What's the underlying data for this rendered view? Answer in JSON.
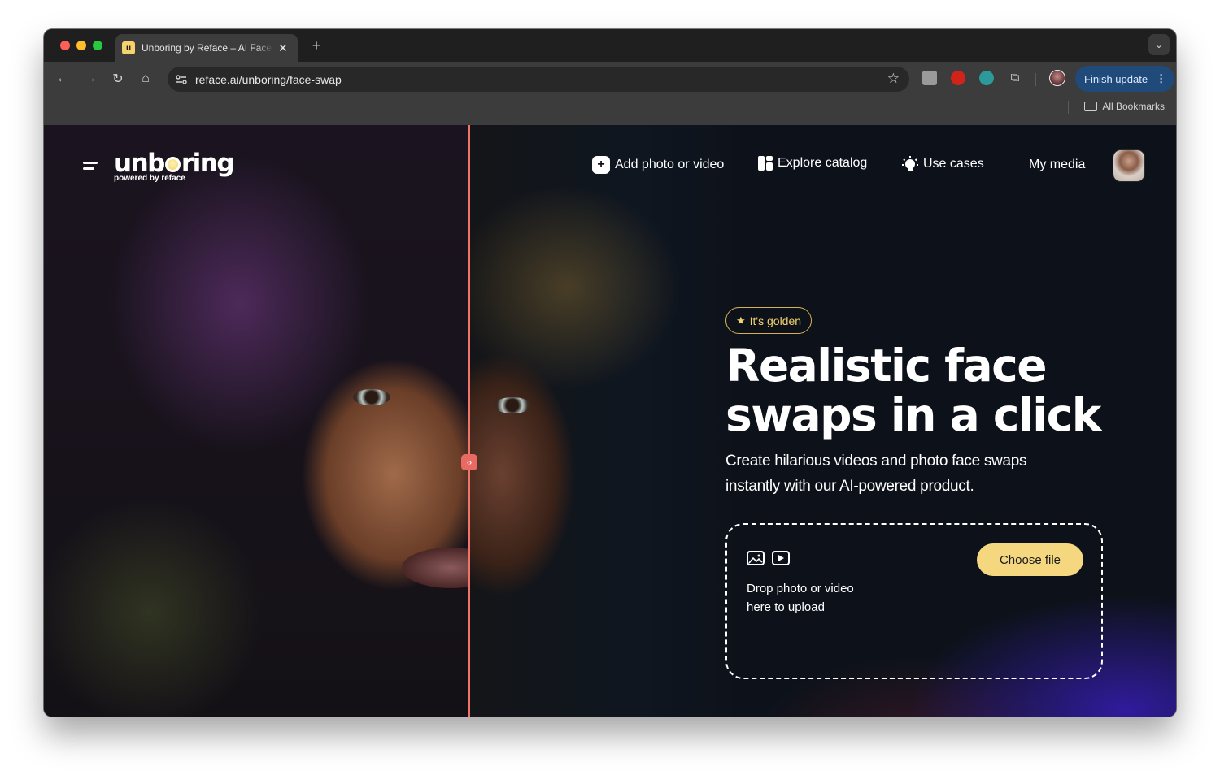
{
  "browser": {
    "tab": {
      "favicon_letter": "u",
      "title": "Unboring by Reface – AI Face Swap"
    },
    "new_tab_label": "+",
    "address_bar": {
      "url": "reface.ai/unboring/face-swap"
    },
    "finish_update_label": "Finish update",
    "bookmarks": {
      "all_bookmarks_label": "All Bookmarks"
    },
    "extensions": [
      "touch-extension",
      "adblock-extension",
      "cloud-extension",
      "extensions-puzzle"
    ]
  },
  "header": {
    "logo": {
      "word_start": "unb",
      "word_end": "ring",
      "subtitle": "powered by reface"
    },
    "nav": [
      {
        "label": "Add photo or video",
        "icon": "plus-square-icon"
      },
      {
        "label": "Explore catalog",
        "icon": "catalog-icon"
      },
      {
        "label": "Use cases",
        "icon": "lightbulb-icon"
      },
      {
        "label": "My media"
      }
    ]
  },
  "hero": {
    "badge": "It's golden",
    "title_line1": "Realistic face",
    "title_line2": "swaps in a click",
    "subtitle": "Create hilarious videos and photo face swaps instantly with our AI-powered product.",
    "dropzone": {
      "text_line1": "Drop photo or video",
      "text_line2": "here to upload",
      "button_label": "Choose file"
    }
  },
  "comparison_slider": {
    "handle_glyph": "‹›"
  },
  "colors": {
    "accent_yellow": "#f5d77f",
    "badge_gold": "#d9b04f",
    "slider_red": "#e86a63",
    "page_bg": "#0d121a",
    "update_button": "#1f4a7a"
  }
}
